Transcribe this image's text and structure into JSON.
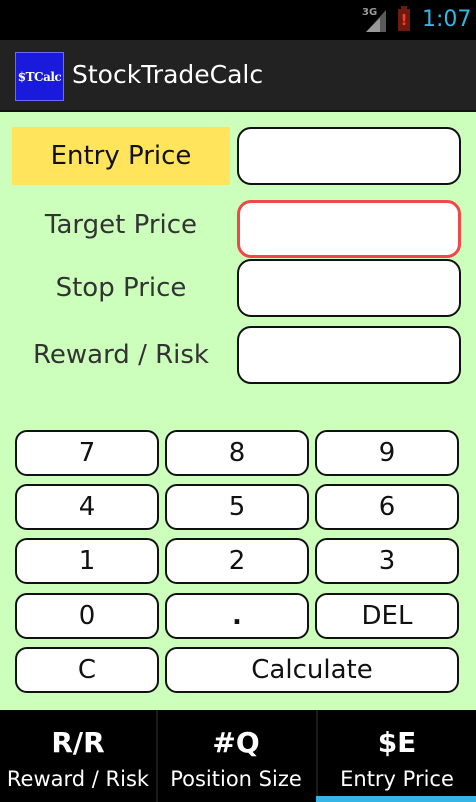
{
  "status_bar": {
    "network": "3G",
    "battery_alert": "!",
    "time": "1:07",
    "time_color": "#33b5e5"
  },
  "app": {
    "title": "StockTradeCalc",
    "icon_text": "$TCalc"
  },
  "fields": [
    {
      "label": "Entry Price",
      "value": "",
      "active": true
    },
    {
      "label": "Target Price",
      "value": "",
      "focused": true
    },
    {
      "label": "Stop Price",
      "value": ""
    },
    {
      "label": "Reward / Risk",
      "value": ""
    }
  ],
  "keypad": {
    "k7": "7",
    "k8": "8",
    "k9": "9",
    "k4": "4",
    "k5": "5",
    "k6": "6",
    "k1": "1",
    "k2": "2",
    "k3": "3",
    "k0": "0",
    "dot": ".",
    "del": "DEL",
    "clear": "C",
    "calculate": "Calculate"
  },
  "tabs": [
    {
      "short": "R/R",
      "label": "Reward / Risk"
    },
    {
      "short": "#Q",
      "label": "Position Size"
    },
    {
      "short": "$E",
      "label": "Entry Price",
      "selected": true
    }
  ],
  "colors": {
    "background": "#ccffbb",
    "active_label": "#ffe45c",
    "focus_border": "#f04848",
    "tab_indicator": "#33b5e5",
    "app_icon": "#1a1adc"
  }
}
